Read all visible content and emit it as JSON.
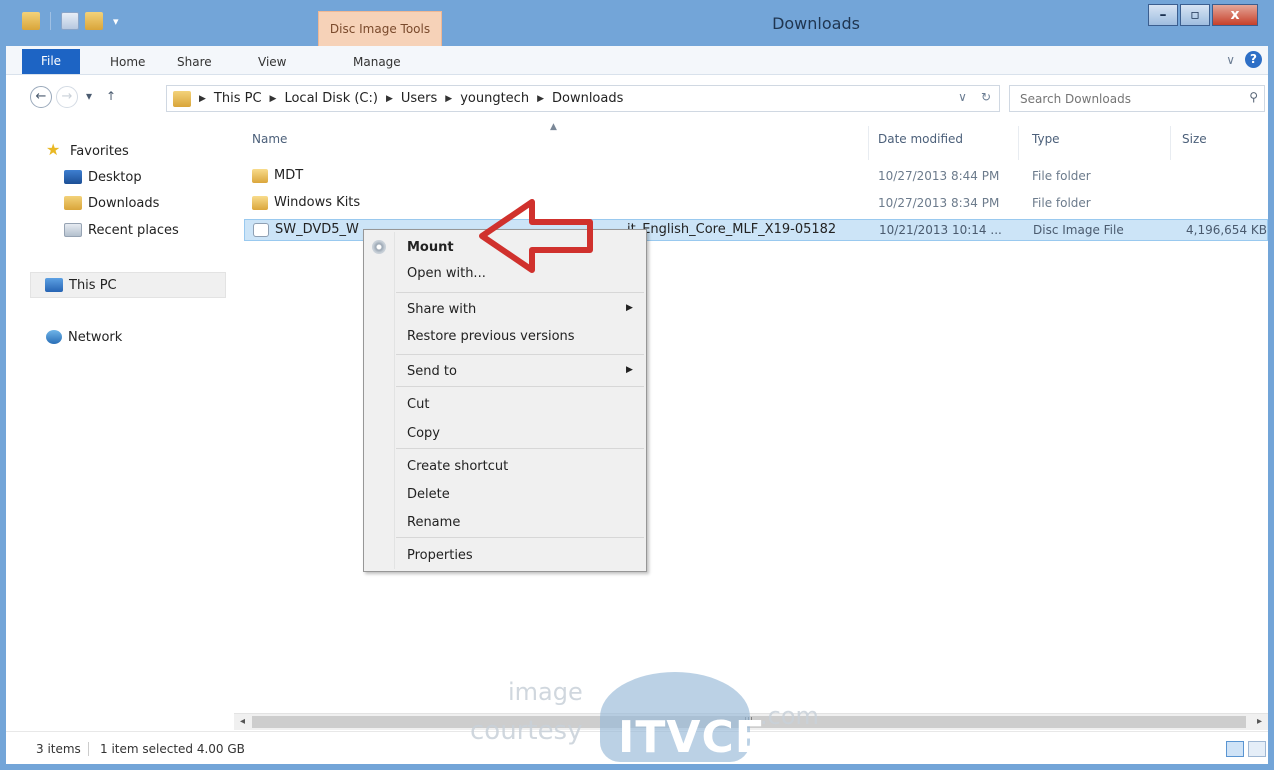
{
  "window": {
    "title": "Downloads",
    "context_tab": "Disc Image Tools",
    "minimize_glyph": "–",
    "maximize_glyph": "▫",
    "close_glyph": "x"
  },
  "ribbon": {
    "tabs": [
      "File",
      "Home",
      "Share",
      "View",
      "Manage"
    ]
  },
  "address": {
    "crumbs": [
      "This PC",
      "Local Disk (C:)",
      "Users",
      "youngtech",
      "Downloads"
    ],
    "search_placeholder": "Search Downloads"
  },
  "nav": {
    "favorites": "Favorites",
    "desktop": "Desktop",
    "downloads": "Downloads",
    "recent": "Recent places",
    "this_pc": "This PC",
    "network": "Network"
  },
  "columns": {
    "name": "Name",
    "date": "Date modified",
    "type": "Type",
    "size": "Size"
  },
  "files": [
    {
      "name": "MDT",
      "date": "10/27/2013 8:44 PM",
      "type": "File folder",
      "size": ""
    },
    {
      "name": "Windows Kits",
      "date": "10/27/2013 8:34 PM",
      "type": "File folder",
      "size": ""
    },
    {
      "name": "SW_DVD5_W",
      "name_tail": "it_English_Core_MLF_X19-05182",
      "date": "10/21/2013 10:14 ...",
      "type": "Disc Image File",
      "size": "4,196,654 KB"
    }
  ],
  "context_menu": {
    "items": [
      {
        "label": "Mount",
        "bold": true
      },
      {
        "label": "Open with..."
      },
      {
        "label": "Share with",
        "submenu": true
      },
      {
        "label": "Restore previous versions"
      },
      {
        "label": "Send to",
        "submenu": true
      },
      {
        "label": "Cut"
      },
      {
        "label": "Copy"
      },
      {
        "label": "Create shortcut"
      },
      {
        "label": "Delete"
      },
      {
        "label": "Rename"
      },
      {
        "label": "Properties"
      }
    ]
  },
  "status": {
    "items": "3 items",
    "selected": "1 item selected  4.00 GB"
  },
  "watermark": {
    "line1": "image",
    "line2": "courtesy",
    "brand": "ITVCE",
    "tld": ".com"
  },
  "colors": {
    "title_bar": "#73a5d8",
    "file_tab": "#1d64c4",
    "context_tab": "#f6d2b8",
    "selection": "#cce4f7",
    "arrow": "#d0312d"
  }
}
